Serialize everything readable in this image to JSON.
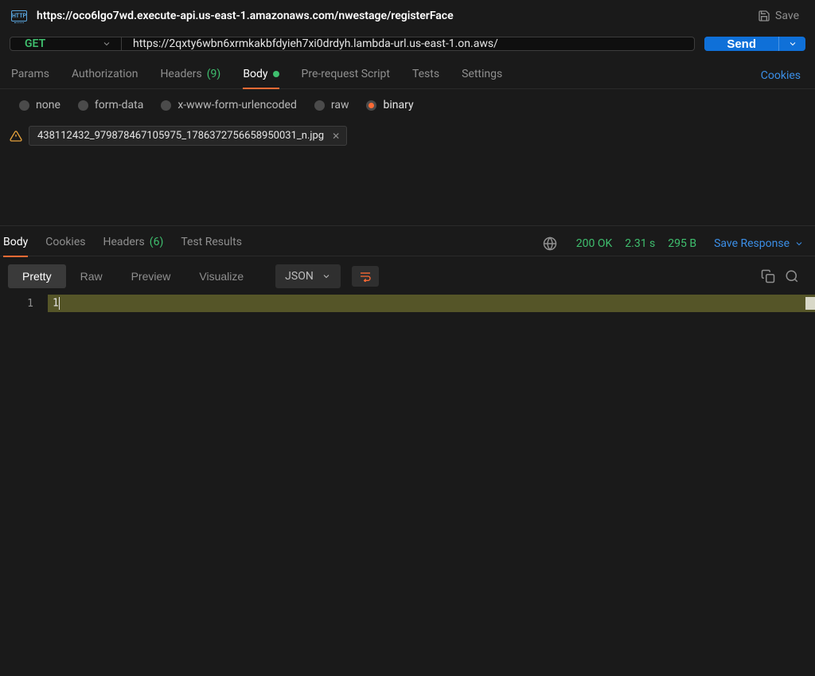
{
  "header": {
    "badge_text": "HTTP",
    "title": "https://oco6lgo7wd.execute-api.us-east-1.amazonaws.com/nwestage/registerFace",
    "save_label": "Save"
  },
  "request": {
    "method": "GET",
    "url": "https://2qxty6wbn6xrmkakbfdyieh7xi0drdyh.lambda-url.us-east-1.on.aws/",
    "send_label": "Send"
  },
  "tabs": {
    "params": "Params",
    "authorization": "Authorization",
    "headers": "Headers",
    "headers_count": "(9)",
    "body": "Body",
    "prerequest": "Pre-request Script",
    "tests": "Tests",
    "settings": "Settings",
    "cookies": "Cookies"
  },
  "body_types": {
    "none": "none",
    "form_data": "form-data",
    "urlencoded": "x-www-form-urlencoded",
    "raw": "raw",
    "binary": "binary"
  },
  "file_chip": {
    "name": "438112432_979878467105975_1786372756658950031_n.jpg"
  },
  "response_tabs": {
    "body": "Body",
    "cookies": "Cookies",
    "headers": "Headers",
    "headers_count": "(6)",
    "test_results": "Test Results"
  },
  "status": {
    "code": "200 OK",
    "time": "2.31 s",
    "size": "295 B",
    "save_response": "Save Response"
  },
  "view": {
    "pretty": "Pretty",
    "raw": "Raw",
    "preview": "Preview",
    "visualize": "Visualize",
    "format": "JSON"
  },
  "editor": {
    "line1_num": "1",
    "line1_content": "1"
  }
}
